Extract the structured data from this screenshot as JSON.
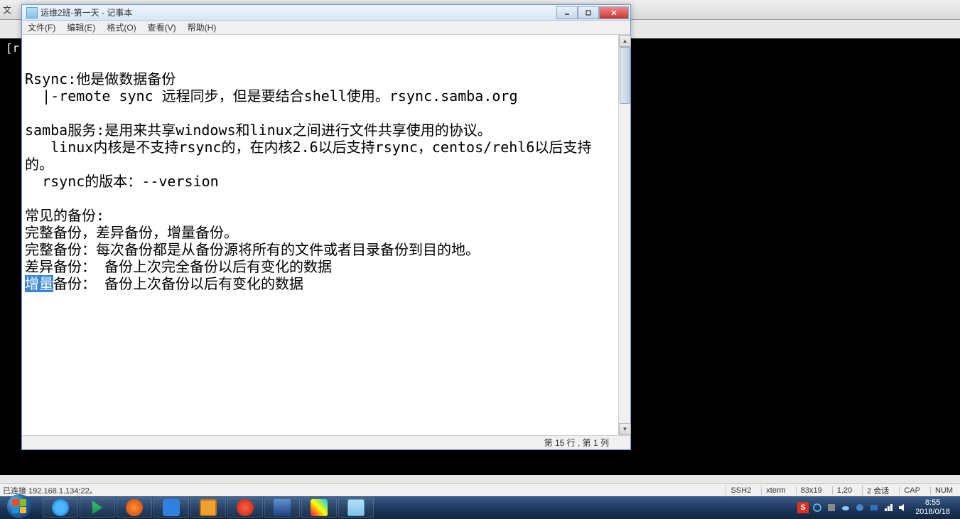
{
  "terminal": {
    "top_label": "文",
    "prompt": "[r"
  },
  "notepad": {
    "title": "运维2班-第一天 - 记事本",
    "menus": {
      "file": "文件(F)",
      "edit": "编辑(E)",
      "format": "格式(O)",
      "view": "查看(V)",
      "help": "帮助(H)"
    },
    "content_pre": "\n\nRsync:他是做数据备份\n  |-remote sync 远程同步，但是要结合shell使用。rsync.samba.org\n\nsamba服务:是用来共享windows和linux之间进行文件共享使用的协议。\n   linux内核是不支持rsync的，在内核2.6以后支持rsync，centos/rehl6以后支持的。\n  rsync的版本：--version\n\n常见的备份:\n完整备份，差异备份，增量备份。\n完整备份：每次备份都是从备份源将所有的文件或者目录备份到目的地。\n差异备份： 备份上次完全备份以后有变化的数据\n",
    "content_sel": "增量",
    "content_post": "备份： 备份上次备份以后有变化的数据",
    "status": "第 15 行 , 第 1 列"
  },
  "ssh": {
    "left": "已连接 192.168.1.134:22。",
    "proto": "SSH2",
    "term": "xterm",
    "size": "83x19",
    "pos": "1,20",
    "sessions": "2 会话",
    "cap": "CAP",
    "num": "NUM"
  },
  "clock": {
    "time": "8:55",
    "date": "2018/0/18"
  },
  "tray": {
    "ime": "S"
  }
}
